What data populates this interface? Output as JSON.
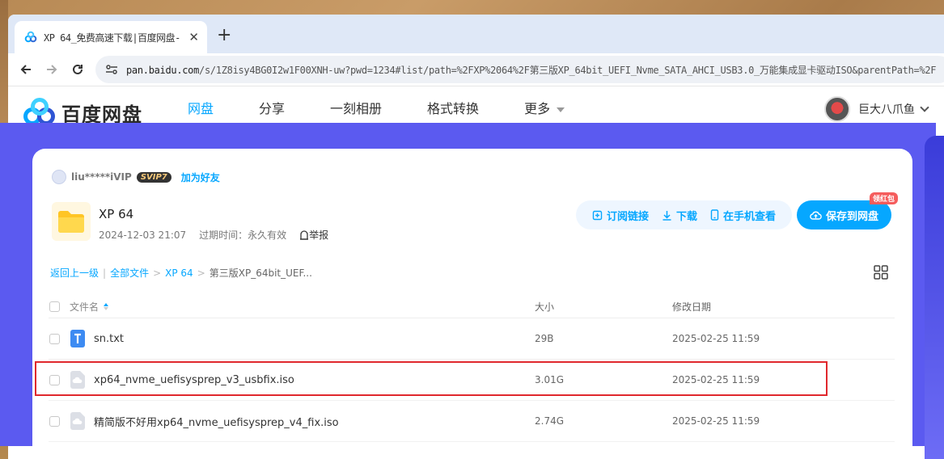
{
  "browser": {
    "tab_title": "XP 64_免费高速下载|百度网盘-",
    "address_host": "pan.baidu.com",
    "address_path": "/s/1Z8isy4BG0I2w1F00XNH-uw?pwd=1234#list/path=%2FXP%2064%2F第三版XP_64bit_UEFI_Nvme_SATA_AHCI_USB3.0_万能集成显卡驱动ISO&parentPath=%2F"
  },
  "header": {
    "logo_text": "百度网盘",
    "nav": [
      "网盘",
      "分享",
      "一刻相册",
      "格式转换",
      "更多"
    ],
    "user_name": "巨大八爪鱼"
  },
  "share": {
    "sharer_name": "liu*****iVIP",
    "svip_badge": "SVIP7",
    "add_friend": "加为好友",
    "folder_title": "XP 64",
    "shared_date": "2024-12-03 21:07",
    "expiry": "过期时间：永久有效",
    "report": "举报",
    "actions": {
      "subscribe": "订阅链接",
      "download": "下载",
      "phone_view": "在手机查看",
      "save": "保存到网盘",
      "redpack": "领红包"
    },
    "breadcrumb": {
      "back": "返回上一级",
      "all_files": "全部文件",
      "folder": "XP 64",
      "current": "第三版XP_64bit_UEF..."
    }
  },
  "table": {
    "headers": {
      "name": "文件名",
      "size": "大小",
      "date": "修改日期"
    },
    "rows": [
      {
        "name": "sn.txt",
        "size": "29B",
        "date": "2025-02-25 11:59",
        "icon": "txt-file-icon"
      },
      {
        "name": "xp64_nvme_uefisysprep_v3_usbfix.iso",
        "size": "3.01G",
        "date": "2025-02-25 11:59",
        "icon": "iso-file-icon"
      },
      {
        "name": "精简版不好用xp64_nvme_uefisysprep_v4_fix.iso",
        "size": "2.74G",
        "date": "2025-02-25 11:59",
        "icon": "iso-file-icon"
      }
    ]
  },
  "colors": {
    "accent": "#06a7ff",
    "page_bg": "#5b5af0",
    "highlight": "#e0282d"
  }
}
